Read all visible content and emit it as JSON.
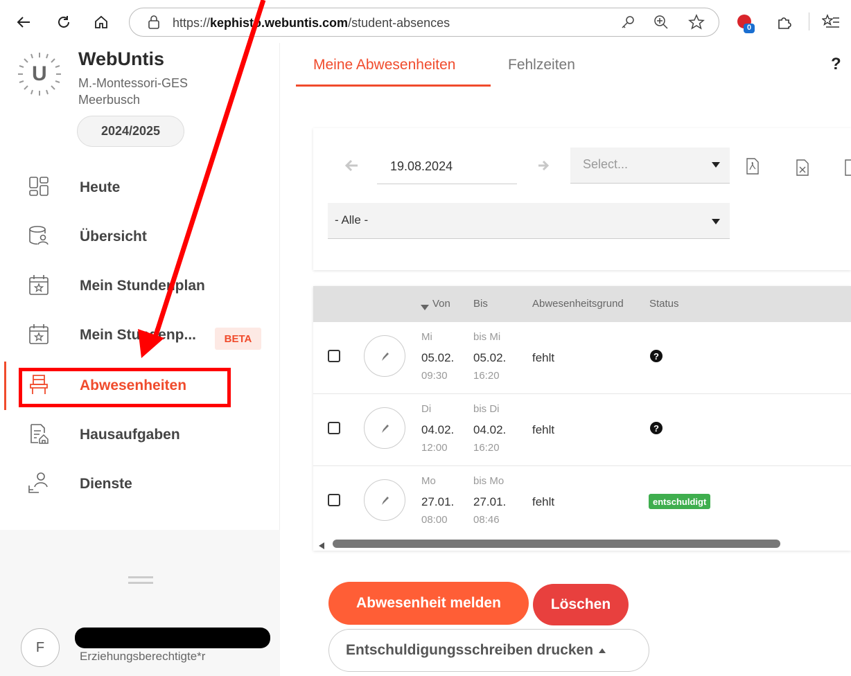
{
  "browser": {
    "url_scheme": "https://",
    "url_host": "kephisto.webuntis.com",
    "url_path": "/student-absences",
    "extension_badge": "0"
  },
  "sidebar": {
    "logo_letter": "U",
    "app_name": "WebUntis",
    "school_line1": "M.-Montessori-GES",
    "school_line2": "Meerbusch",
    "school_year": "2024/2025",
    "items": [
      {
        "label": "Heute",
        "icon": "dashboard-icon"
      },
      {
        "label": "Übersicht",
        "icon": "overview-icon"
      },
      {
        "label": "Mein Stundenplan",
        "icon": "calendar-star-icon"
      },
      {
        "label": "Mein Stundenp...",
        "icon": "calendar-star-icon",
        "badge": "BETA"
      },
      {
        "label": "Abwesenheiten",
        "icon": "chair-icon",
        "active": true
      },
      {
        "label": "Hausaufgaben",
        "icon": "homework-icon"
      },
      {
        "label": "Dienste",
        "icon": "duties-icon"
      }
    ],
    "user": {
      "avatar_letter": "F",
      "role": "Erziehungsberechtigte*r"
    }
  },
  "tabs": [
    {
      "label": "Meine Abwesenheiten",
      "active": true
    },
    {
      "label": "Fehlzeiten",
      "active": false
    }
  ],
  "help_label": "?",
  "filters": {
    "date": "19.08.2024",
    "select_placeholder": "Select...",
    "filter_value": "- Alle -"
  },
  "table": {
    "headers": {
      "from": "Von",
      "to": "Bis",
      "reason": "Abwesenheitsgrund",
      "status": "Status"
    },
    "rows": [
      {
        "from_day": "Mi",
        "from_date": "05.02.",
        "from_time": "09:30",
        "to_day": "bis Mi",
        "to_date": "05.02.",
        "to_time": "16:20",
        "reason": "fehlt",
        "status": "unknown"
      },
      {
        "from_day": "Di",
        "from_date": "04.02.",
        "from_time": "12:00",
        "to_day": "bis Di",
        "to_date": "04.02.",
        "to_time": "16:20",
        "reason": "fehlt",
        "status": "unknown"
      },
      {
        "from_day": "Mo",
        "from_date": "27.01.",
        "from_time": "08:00",
        "to_day": "bis Mo",
        "to_date": "27.01.",
        "to_time": "08:46",
        "reason": "fehlt",
        "status": "entschuldigt"
      }
    ]
  },
  "actions": {
    "report": "Abwesenheit melden",
    "delete": "Löschen",
    "print": "Entschuldigungsschreiben drucken"
  },
  "colors": {
    "accent": "#f04b2c",
    "delete": "#e8403e",
    "excused": "#3fae4e",
    "annotation": "#ff0000"
  }
}
